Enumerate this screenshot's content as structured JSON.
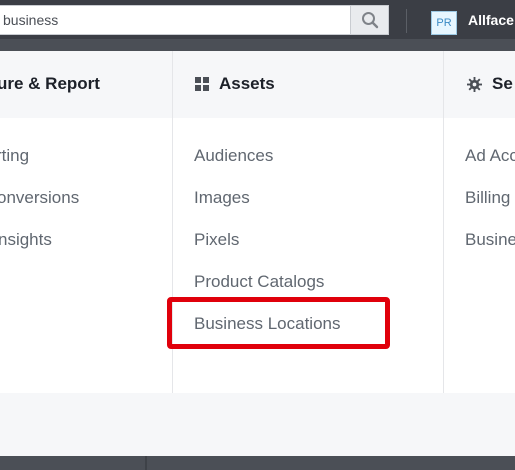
{
  "search": {
    "value": "business",
    "icon": "search-icon"
  },
  "account": {
    "avatar_text": "PR",
    "name": "Allface"
  },
  "columns": [
    {
      "title": "ure & Report",
      "items": [
        "rting",
        "onversions",
        "nsights"
      ]
    },
    {
      "title": "Assets",
      "icon": "grid-icon",
      "items": [
        "Audiences",
        "Images",
        "Pixels",
        "Product Catalogs",
        "Business Locations"
      ]
    },
    {
      "title": "Se",
      "icon": "gear-icon",
      "items": [
        "Ad Acc",
        "Billing",
        "Busine"
      ]
    }
  ],
  "colors": {
    "topbar": "#3b3e45",
    "highlight": "#e0000b",
    "item_text": "#606770",
    "header_text": "#1d2129"
  }
}
